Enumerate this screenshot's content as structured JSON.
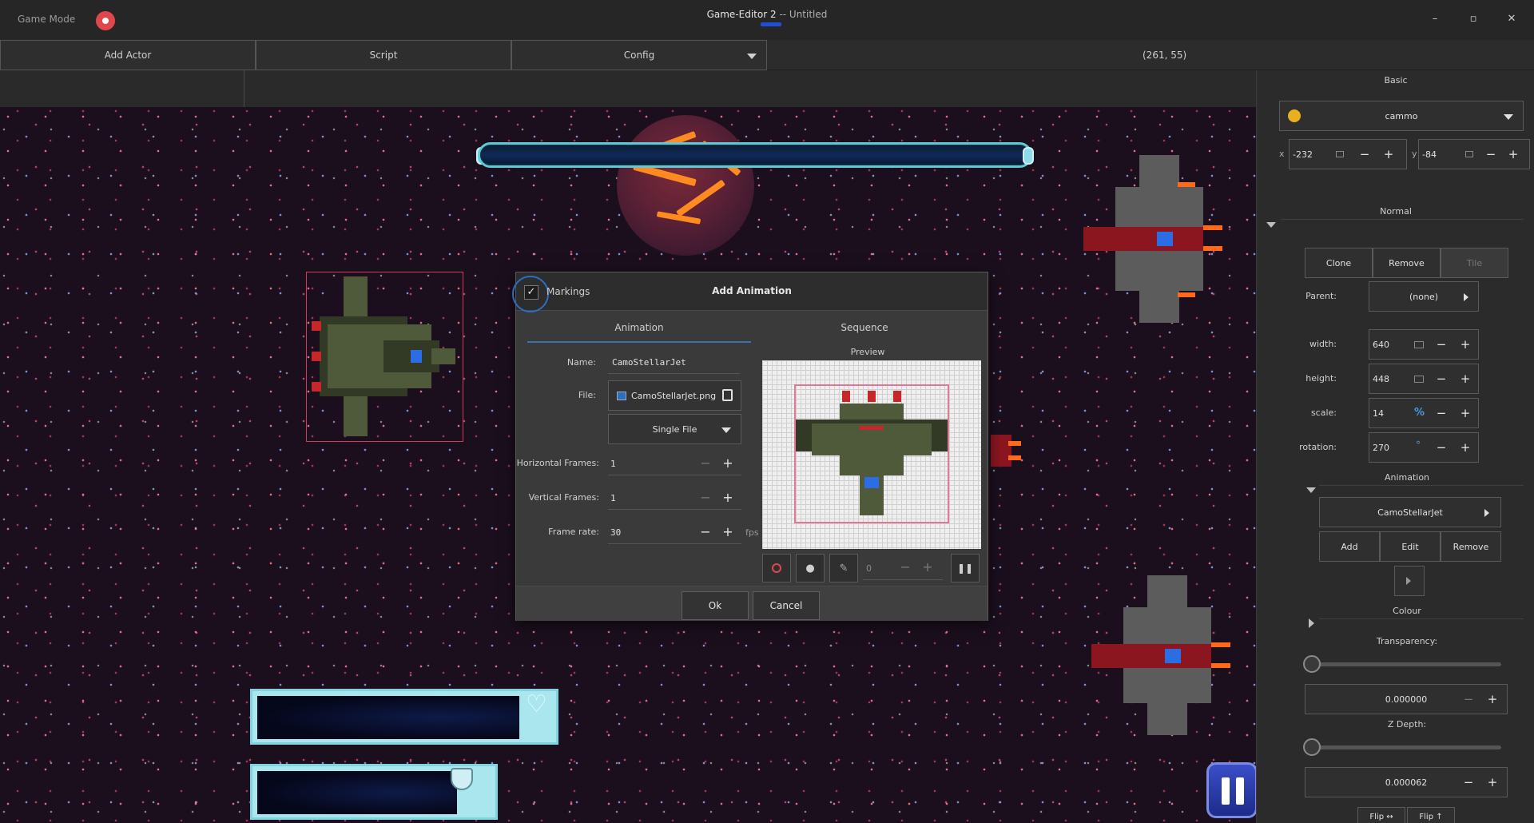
{
  "titlebar": {
    "mode_label": "Game Mode",
    "app_title": "Game-Editor 2",
    "doc_title": " -- Untitled",
    "minimize_glyph": "–",
    "maximize_glyph": "▫",
    "close_glyph": "✕"
  },
  "toolbar": {
    "add_actor": "Add Actor",
    "script": "Script",
    "config": "Config",
    "coords": "(261, 55)"
  },
  "dialog": {
    "title": "Add Animation",
    "markings_label": "Markings",
    "markings_checked": true,
    "tabs": [
      "Animation",
      "Sequence"
    ],
    "name_label": "Name:",
    "name_value": "CamoStellarJet",
    "file_label": "File:",
    "file_value": "CamoStellarJet.png",
    "file_mode": "Single File",
    "hframes_label": "Horizontal Frames:",
    "hframes_value": "1",
    "vframes_label": "Vertical Frames:",
    "vframes_value": "1",
    "framerate_label": "Frame rate:",
    "framerate_value": "30",
    "fps_unit": "fps",
    "preview_title": "Preview",
    "frame_counter": "0",
    "ok": "Ok",
    "cancel": "Cancel"
  },
  "panel": {
    "basic_title": "Basic",
    "actor_name": "cammo",
    "x_label": "x",
    "x_value": "-232",
    "y_label": "y",
    "y_value": "-84",
    "normal_title": "Normal",
    "clone": "Clone",
    "remove": "Remove",
    "tile": "Tile",
    "parent_label": "Parent:",
    "parent_value": "(none)",
    "width_label": "width:",
    "width_value": "640",
    "height_label": "height:",
    "height_value": "448",
    "scale_label": "scale:",
    "scale_value": "14",
    "scale_unit": "%",
    "rotation_label": "rotation:",
    "rotation_value": "270",
    "rotation_unit": "°",
    "animation_title": "Animation",
    "animation_value": "CamoStellarJet",
    "anim_add": "Add",
    "anim_edit": "Edit",
    "anim_remove": "Remove",
    "colour_title": "Colour",
    "transparency_label": "Transparency:",
    "transparency_value": "0.000000",
    "zdepth_label": "Z Depth:",
    "zdepth_value": "0.000062",
    "flip_h": "Flip ↔",
    "flip_v": "Flip ↑"
  },
  "colors": {
    "accent": "#2d6dbd",
    "record": "#e0474c",
    "selection": "#d3385a",
    "hud": "#7fd4e0"
  }
}
